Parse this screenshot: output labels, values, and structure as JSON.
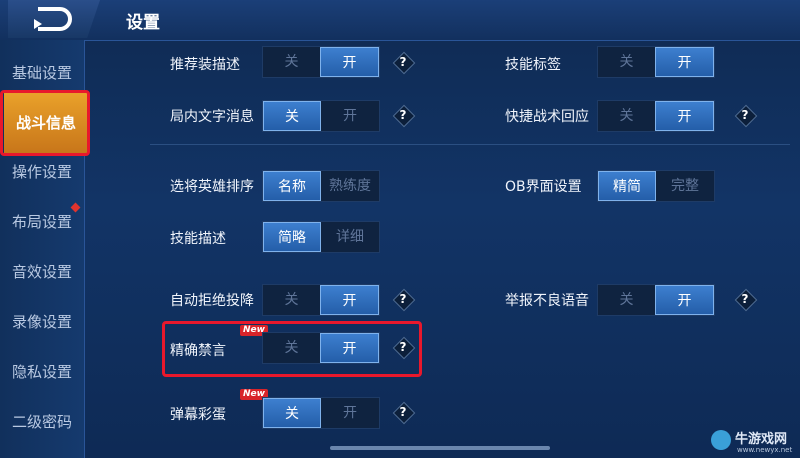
{
  "header": {
    "title": "设置"
  },
  "sidebar": {
    "items": [
      {
        "label": "基础设置"
      },
      {
        "label": "战斗信息"
      },
      {
        "label": "操作设置"
      },
      {
        "label": "布局设置"
      },
      {
        "label": "音效设置"
      },
      {
        "label": "录像设置"
      },
      {
        "label": "隐私设置"
      },
      {
        "label": "二级密码"
      }
    ],
    "active": "战斗信息"
  },
  "settings": {
    "recommend_desc": {
      "label": "推荐装描述",
      "off": "关",
      "on": "开",
      "selected": "开"
    },
    "skill_tag": {
      "label": "技能标签",
      "off": "关",
      "on": "开",
      "selected": "开"
    },
    "in_game_text": {
      "label": "局内文字消息",
      "off": "关",
      "on": "开",
      "selected": "关"
    },
    "quick_tactics": {
      "label": "快捷战术回应",
      "off": "关",
      "on": "开",
      "selected": "开"
    },
    "hero_sort": {
      "label": "选将英雄排序",
      "a": "名称",
      "b": "熟练度",
      "selected": "名称"
    },
    "ob_ui": {
      "label": "OB界面设置",
      "a": "精简",
      "b": "完整",
      "selected": "精简"
    },
    "skill_desc": {
      "label": "技能描述",
      "a": "简略",
      "b": "详细",
      "selected": "简略"
    },
    "auto_reject_surrender": {
      "label": "自动拒绝投降",
      "off": "关",
      "on": "开",
      "selected": "开"
    },
    "report_bad_voice": {
      "label": "举报不良语音",
      "off": "关",
      "on": "开",
      "selected": "开"
    },
    "precise_mute": {
      "label": "精确禁言",
      "badge": "New",
      "off": "关",
      "on": "开",
      "selected": "开"
    },
    "danmaku_egg": {
      "label": "弹幕彩蛋",
      "badge": "New",
      "off": "关",
      "on": "开",
      "selected": "关"
    },
    "help": "?"
  },
  "watermark": {
    "text": "牛游戏网",
    "url": "www.newyx.net"
  }
}
